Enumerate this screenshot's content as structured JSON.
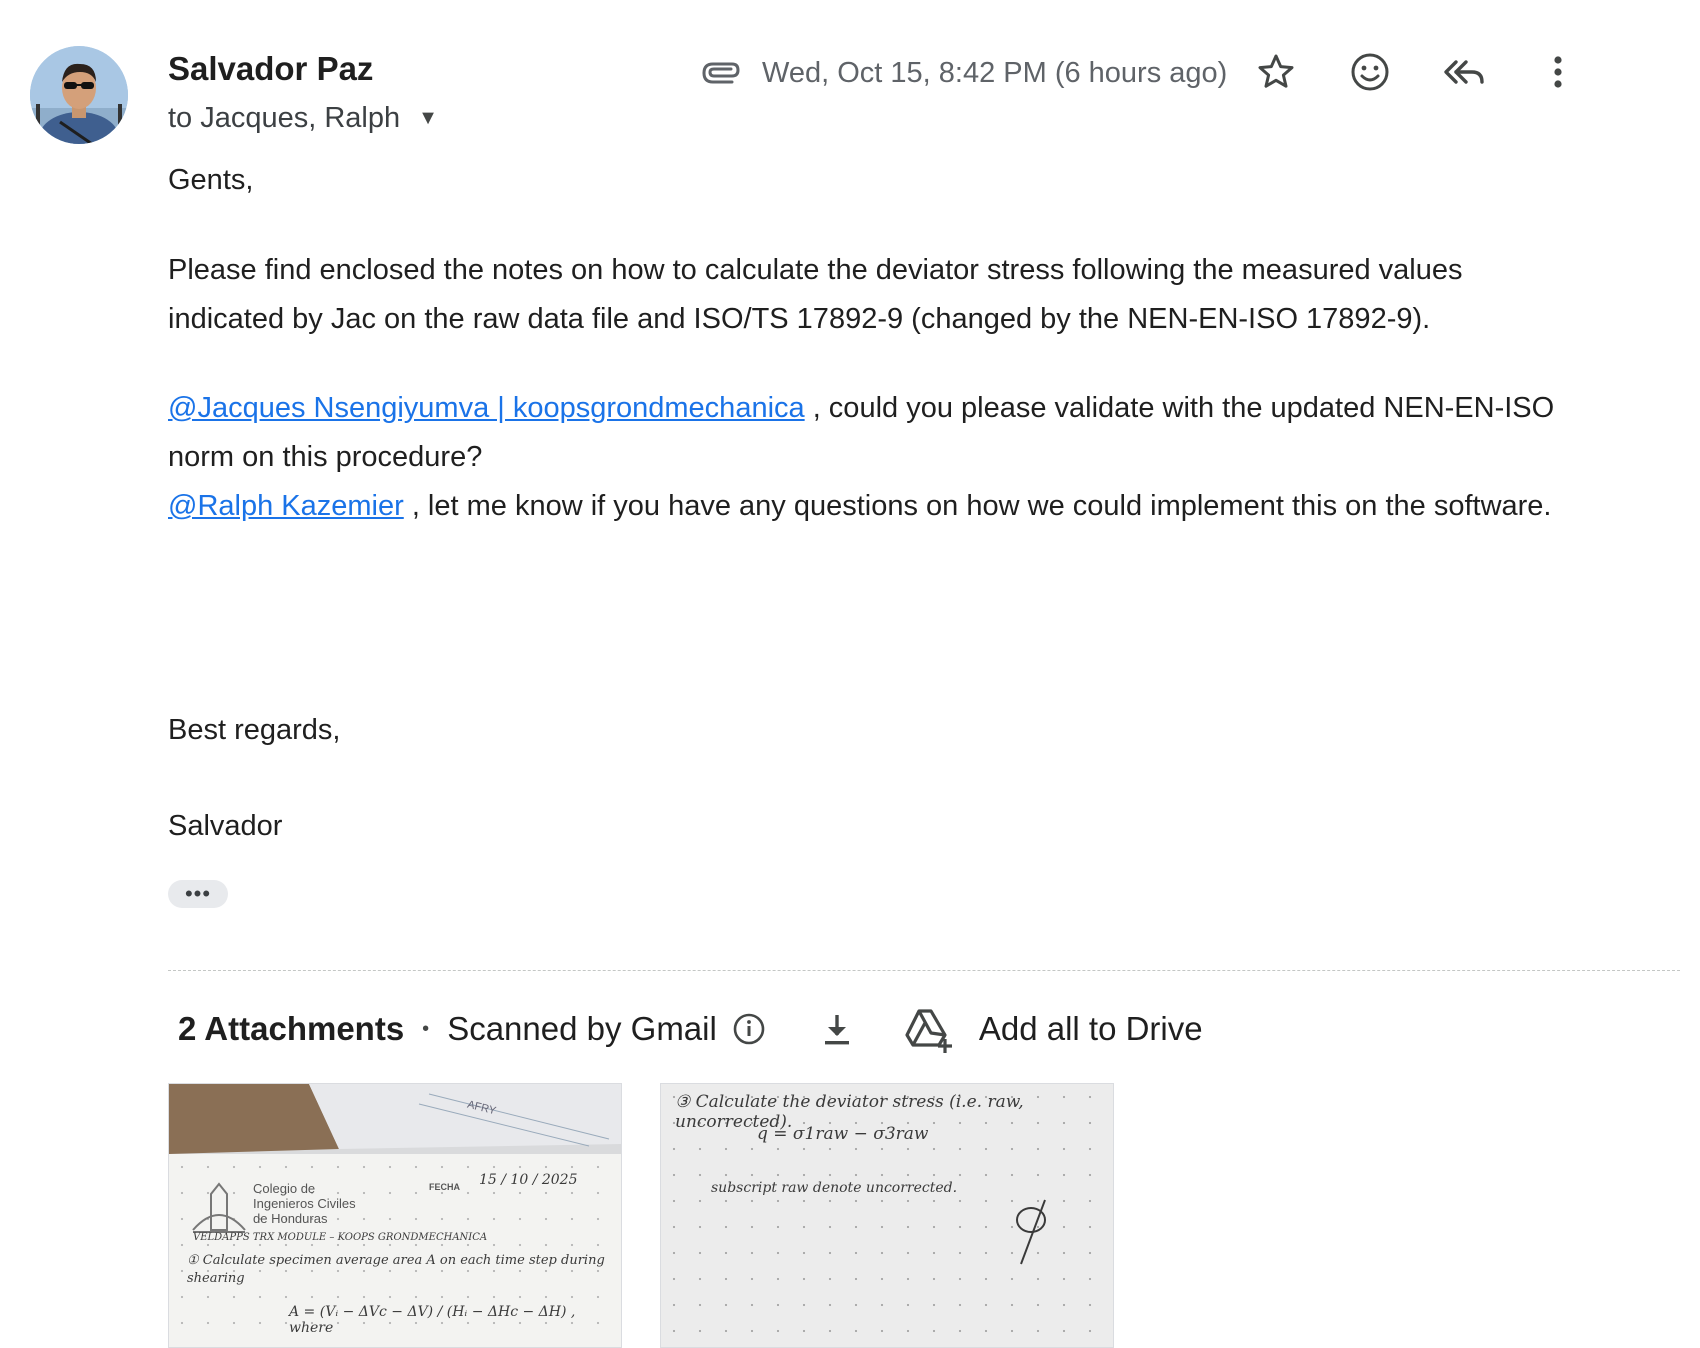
{
  "sender": {
    "name": "Salvador Paz",
    "recipients_prefix": "to",
    "recipients": "Jacques, Ralph"
  },
  "meta": {
    "date": "Wed, Oct 15, 8:42 PM (6 hours ago)"
  },
  "header_icons": [
    "attachment-clip-icon",
    "star-icon",
    "emoji-icon",
    "reply-all-icon",
    "more-vert-icon"
  ],
  "body": {
    "greeting": "Gents,",
    "para1": "Please find enclosed the notes on how to calculate the deviator stress following the measured values indicated by Jac on the raw data file and ISO/TS 17892-9 (changed by the NEN-EN-ISO 17892-9).",
    "mention1": "@Jacques Nsengiyumva | koopsgrondmechanica",
    "para2_rest": " , could you please validate with the updated NEN-EN-ISO norm on this procedure?",
    "mention2": "@Ralph Kazemier",
    "para3_rest": " , let me know if you have any questions on how we could implement this on the software.",
    "closing": "Best regards,",
    "signature": "Salvador",
    "trimmed_content": "•••"
  },
  "attachments": {
    "count_label": "2 Attachments",
    "separator": "•",
    "scanned_label": "Scanned by Gmail",
    "drive_label": "Add all to Drive",
    "items": [
      {
        "org_line1": "Colegio de",
        "org_line2": "Ingenieros Civiles",
        "org_line3": "de Honduras",
        "fecha_label": "FECHA",
        "date": "15 / 10 / 2025",
        "heading": "VELDAPPS TRX MODULE – KOOPS GRONDMECHANICA",
        "step": "① Calculate specimen average area A on each time step during shearing",
        "formula": "A = (Vᵢ − ΔVc − ΔV) / (Hᵢ − ΔHc − ΔH) , where",
        "stamp": "AFRY"
      },
      {
        "step": "③ Calculate the deviator stress (i.e. raw, uncorrected).",
        "formula": "q = σ1raw − σ3raw",
        "note": "subscript raw denote uncorrected."
      }
    ]
  }
}
